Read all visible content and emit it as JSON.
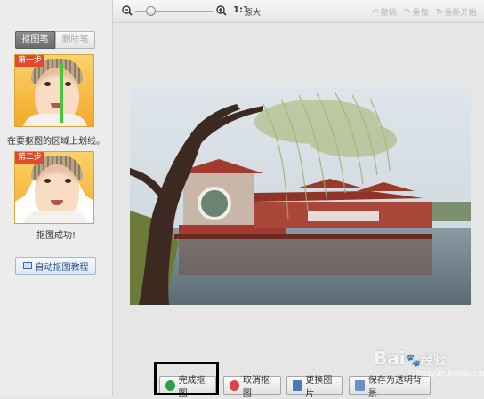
{
  "left_panel": {
    "tab_active": "抠图笔",
    "tab_inactive": "删除笔",
    "step1_label": "第一步",
    "step1_text": "在要抠图的区域上划线。",
    "step2_label": "第二步",
    "step2_text": "抠图成功!",
    "tutorial_button": "自动抠图教程"
  },
  "toolbar": {
    "zoom_ratio": "1:1",
    "original_label": "原大",
    "undo": "撤销",
    "redo": "重做",
    "restart": "重新开始",
    "zoom_level": 0.2
  },
  "bottom_buttons": {
    "done": "完成抠图",
    "cancel": "取消抠图",
    "replace": "更换图片",
    "save_transparent": "保存为透明背景"
  },
  "watermark": {
    "brand": "Bai",
    "brand2": "经验",
    "url": "jingyan.baidu.com"
  },
  "colors": {
    "accent_green": "#2ea043",
    "cancel_red": "#d9434a",
    "step_label_red": "#e24a2b"
  }
}
